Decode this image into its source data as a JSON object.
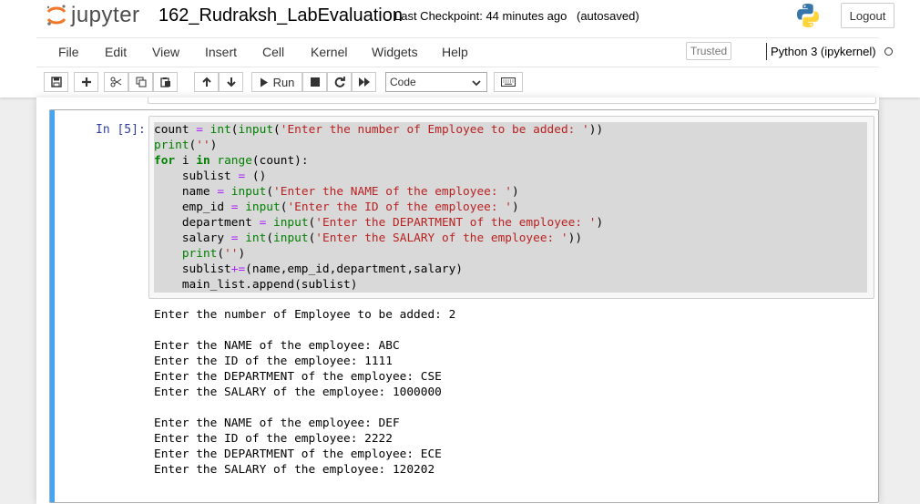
{
  "header": {
    "logo_text": "jupyter",
    "notebook_name": "162_Rudraksh_LabEvaluation",
    "checkpoint": "Last Checkpoint: 44 minutes ago",
    "autosave_status": "(autosaved)",
    "logout_label": "Logout"
  },
  "menubar": {
    "items": [
      "File",
      "Edit",
      "View",
      "Insert",
      "Cell",
      "Kernel",
      "Widgets",
      "Help"
    ],
    "trusted_label": "Trusted",
    "kernel_name": "Python 3 (ipykernel)"
  },
  "toolbar": {
    "run_label": "Run",
    "cell_type": "Code",
    "icons": [
      "save-icon",
      "plus-icon",
      "cut-icon",
      "copy-icon",
      "paste-icon",
      "arrow-up-icon",
      "arrow-down-icon",
      "play-icon",
      "stop-icon",
      "restart-icon",
      "fast-forward-icon",
      "keyboard-icon"
    ]
  },
  "cell": {
    "prompt": "In [5]:",
    "code_lines": [
      [
        {
          "t": "count ",
          "c": ""
        },
        {
          "t": "=",
          "c": "op"
        },
        {
          "t": " ",
          "c": ""
        },
        {
          "t": "int",
          "c": "bi"
        },
        {
          "t": "(",
          "c": ""
        },
        {
          "t": "input",
          "c": "bi"
        },
        {
          "t": "(",
          "c": ""
        },
        {
          "t": "'Enter the number of Employee to be added: '",
          "c": "st"
        },
        {
          "t": "))",
          "c": ""
        }
      ],
      [
        {
          "t": "print",
          "c": "bi"
        },
        {
          "t": "(",
          "c": ""
        },
        {
          "t": "''",
          "c": "st"
        },
        {
          "t": ")",
          "c": ""
        }
      ],
      [
        {
          "t": "for",
          "c": "kw"
        },
        {
          "t": " i ",
          "c": ""
        },
        {
          "t": "in",
          "c": "kw"
        },
        {
          "t": " ",
          "c": ""
        },
        {
          "t": "range",
          "c": "bi"
        },
        {
          "t": "(count):",
          "c": ""
        }
      ],
      [
        {
          "t": "    sublist ",
          "c": ""
        },
        {
          "t": "=",
          "c": "op"
        },
        {
          "t": " ()",
          "c": ""
        }
      ],
      [
        {
          "t": "    name ",
          "c": ""
        },
        {
          "t": "=",
          "c": "op"
        },
        {
          "t": " ",
          "c": ""
        },
        {
          "t": "input",
          "c": "bi"
        },
        {
          "t": "(",
          "c": ""
        },
        {
          "t": "'Enter the NAME of the employee: '",
          "c": "st"
        },
        {
          "t": ")",
          "c": ""
        }
      ],
      [
        {
          "t": "    emp_id ",
          "c": ""
        },
        {
          "t": "=",
          "c": "op"
        },
        {
          "t": " ",
          "c": ""
        },
        {
          "t": "input",
          "c": "bi"
        },
        {
          "t": "(",
          "c": ""
        },
        {
          "t": "'Enter the ID of the employee: '",
          "c": "st"
        },
        {
          "t": ")",
          "c": ""
        }
      ],
      [
        {
          "t": "    department ",
          "c": ""
        },
        {
          "t": "=",
          "c": "op"
        },
        {
          "t": " ",
          "c": ""
        },
        {
          "t": "input",
          "c": "bi"
        },
        {
          "t": "(",
          "c": ""
        },
        {
          "t": "'Enter the DEPARTMENT of the employee: '",
          "c": "st"
        },
        {
          "t": ")",
          "c": ""
        }
      ],
      [
        {
          "t": "    salary ",
          "c": ""
        },
        {
          "t": "=",
          "c": "op"
        },
        {
          "t": " ",
          "c": ""
        },
        {
          "t": "int",
          "c": "bi"
        },
        {
          "t": "(",
          "c": ""
        },
        {
          "t": "input",
          "c": "bi"
        },
        {
          "t": "(",
          "c": ""
        },
        {
          "t": "'Enter the SALARY of the employee: '",
          "c": "st"
        },
        {
          "t": "))",
          "c": ""
        }
      ],
      [
        {
          "t": "    ",
          "c": ""
        },
        {
          "t": "print",
          "c": "bi"
        },
        {
          "t": "(",
          "c": ""
        },
        {
          "t": "''",
          "c": "st"
        },
        {
          "t": ")",
          "c": ""
        }
      ],
      [
        {
          "t": "    sublist",
          "c": ""
        },
        {
          "t": "+=",
          "c": "op"
        },
        {
          "t": "(name,emp_id,department,salary)",
          "c": ""
        }
      ],
      [
        {
          "t": "    main_list.append(sublist)",
          "c": ""
        }
      ]
    ],
    "output_lines": [
      "Enter the number of Employee to be added: 2",
      "",
      "Enter the NAME of the employee: ABC",
      "Enter the ID of the employee: 1111",
      "Enter the DEPARTMENT of the employee: CSE",
      "Enter the SALARY of the employee: 1000000",
      "",
      "Enter the NAME of the employee: DEF",
      "Enter the ID of the employee: 2222",
      "Enter the DEPARTMENT of the employee: ECE",
      "Enter the SALARY of the employee: 120202"
    ]
  }
}
